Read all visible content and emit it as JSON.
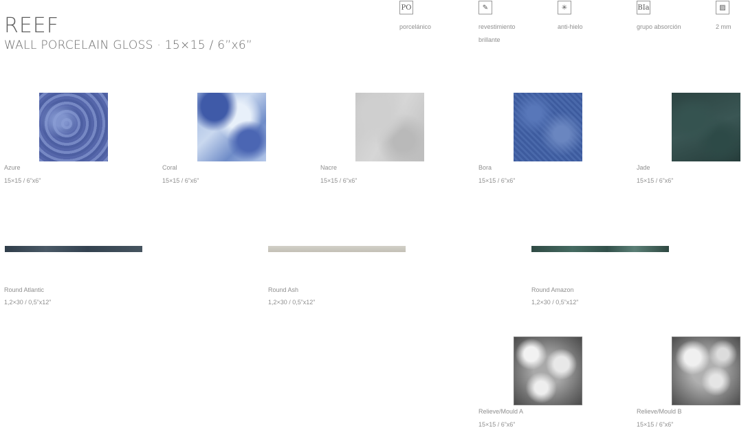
{
  "header": {
    "title": "REEF",
    "subtitle": "WALL PORCELAIN GLOSS · 15×15 / 6”x6”"
  },
  "features": [
    {
      "icon_text": "PO",
      "icon": "porcelain-icon",
      "label": "porcelánico"
    },
    {
      "icon_text": "✎",
      "icon": "gloss-wall-icon",
      "label": "revestimiento brillante"
    },
    {
      "icon_text": "✳",
      "icon": "frost-icon",
      "label": "anti-hielo"
    },
    {
      "icon_text": "BIa",
      "icon": "absorption-icon",
      "label": "grupo absorción"
    },
    {
      "icon_text": "▨",
      "icon": "thickness-icon",
      "label": "2 mm"
    }
  ],
  "tiles": [
    {
      "name": "Azure",
      "size": "15×15 / 6”x6”"
    },
    {
      "name": "Coral",
      "size": "15×15 / 6”x6”"
    },
    {
      "name": "Nacre",
      "size": "15×15 / 6”x6”"
    },
    {
      "name": "Bora",
      "size": "15×15 / 6”x6”"
    },
    {
      "name": "Jade",
      "size": "15×15 / 6”x6”"
    }
  ],
  "strips": [
    {
      "name": "Round Atlantic",
      "size": "1,2×30 / 0,5”x12”"
    },
    {
      "name": "Round Ash",
      "size": "1,2×30 / 0,5”x12”"
    },
    {
      "name": "Round Amazon",
      "size": "1,2×30 / 0,5”x12”"
    }
  ],
  "moulds": [
    {
      "name": "Relieve/Mould A",
      "size": "15×15 / 6”x6”"
    },
    {
      "name": "Relieve/Mould B",
      "size": "15×15 / 6”x6”"
    }
  ]
}
